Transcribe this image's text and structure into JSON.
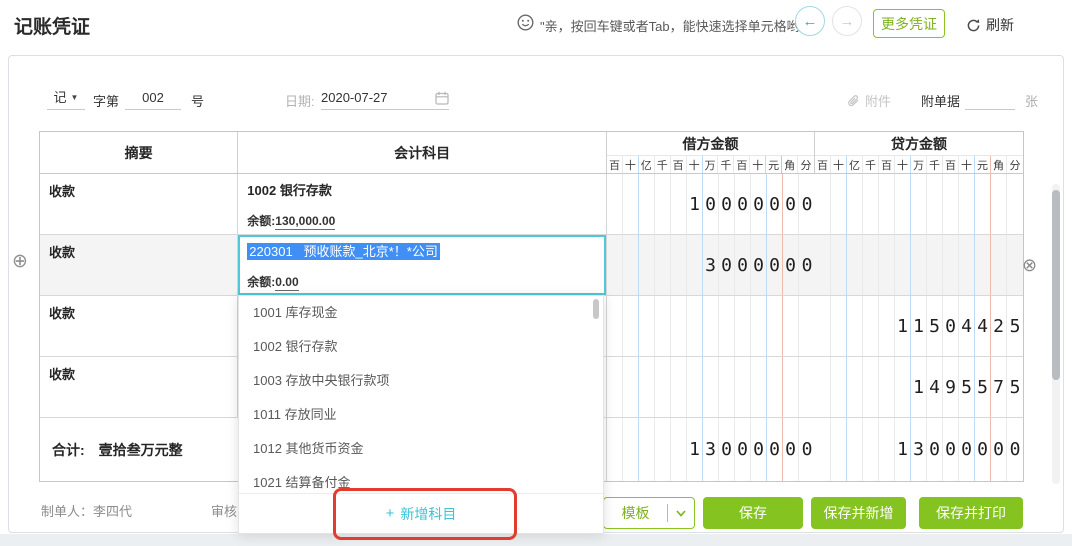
{
  "header": {
    "title": "记账凭证",
    "tip": "\"亲，按回车键或者Tab，能快速选择单元格哟！\"",
    "prev_icon": "←",
    "next_icon": "→",
    "more_vouchers_label": "更多凭证",
    "refresh_label": "刷新"
  },
  "voucher_form": {
    "word_type": "记",
    "word_label": "字第",
    "number_value": "002",
    "number_suffix": "号",
    "date_label": "日期:",
    "date_value": "2020-07-27",
    "attachment_label": "附件",
    "attachment_doc_label": "附单据",
    "attachment_unit": "张"
  },
  "table": {
    "headers": {
      "summary": "摘要",
      "account": "会计科目",
      "debit": "借方金额",
      "credit": "贷方金额"
    },
    "digit_columns": [
      "百",
      "十",
      "亿",
      "千",
      "百",
      "十",
      "万",
      "千",
      "百",
      "十",
      "元",
      "角",
      "分"
    ],
    "rows": [
      {
        "summary": "收款",
        "account": "1002 银行存款",
        "balance_label": "余额:",
        "balance": "130,000.00",
        "debit": "10000000",
        "credit": "",
        "selected": false,
        "shaded": false
      },
      {
        "summary": "收款",
        "account": "220301   预收账款_北京*！*公司",
        "balance_label": "余额:",
        "balance": "0.00",
        "debit": "3000000",
        "credit": "",
        "selected": true,
        "shaded": true
      },
      {
        "summary": "收款",
        "account": "",
        "debit": "",
        "credit": "11504425",
        "selected": false,
        "shaded": false
      },
      {
        "summary": "收款",
        "account": "",
        "debit": "",
        "credit": "1495575",
        "selected": false,
        "shaded": false
      }
    ],
    "total_row": {
      "label": "合计:",
      "amount_text": "壹拾叁万元整",
      "debit": "13000000",
      "credit": "13000000"
    }
  },
  "account_dropdown": {
    "items": [
      "1001 库存现金",
      "1002 银行存款",
      "1003 存放中央银行款项",
      "1011 存放同业",
      "1012 其他货币资金",
      "1021 结算备付金"
    ],
    "add_icon": "+",
    "add_label": "新增科目"
  },
  "footer": {
    "creator_label": "制单人：",
    "creator_name": "李四代",
    "reviewer_label": "审核",
    "template_label": "模板",
    "save_label": "保存",
    "save_new_label": "保存并新增",
    "save_print_label": "保存并打印"
  },
  "colors": {
    "accent_green": "#85c320",
    "accent_cyan": "#3ec1d3",
    "selection_blue": "#3f8ff5",
    "annotation_red": "#e23c2e"
  }
}
